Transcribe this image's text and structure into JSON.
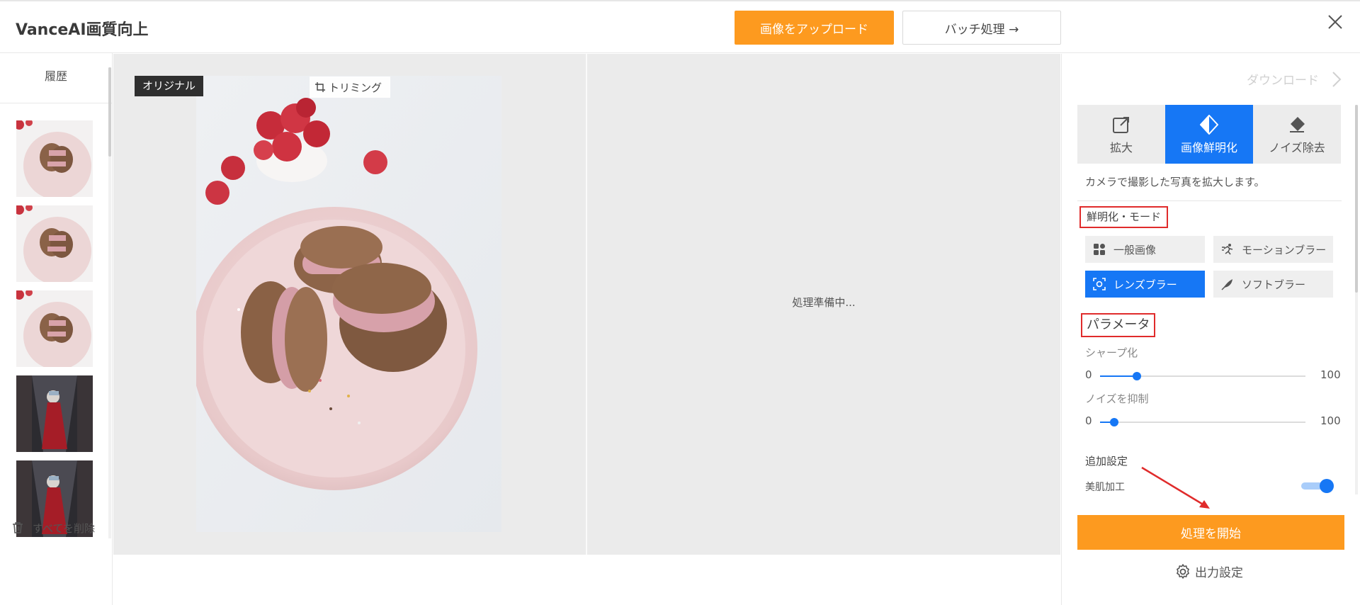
{
  "header": {
    "app_title": "VanceAI画質向上",
    "upload_label": "画像をアップロード",
    "batch_label": "バッチ処理 →"
  },
  "history": {
    "title": "履歴",
    "thumbnails": [
      "cookie-photo",
      "cookie-photo",
      "cookie-photo",
      "red-dress-alley-photo",
      "red-dress-alley-photo"
    ],
    "delete_all_label": "すべてを削除"
  },
  "preview": {
    "original_tag": "オリジナル",
    "trim_label": "トリミング",
    "processing_text": "処理準備中..."
  },
  "panel": {
    "download_label": "ダウンロード",
    "tabs": [
      {
        "label": "拡大",
        "icon": "enlarge-icon",
        "active": false
      },
      {
        "label": "画像鮮明化",
        "icon": "sharpen-icon",
        "active": true
      },
      {
        "label": "ノイズ除去",
        "icon": "eraser-icon",
        "active": false
      }
    ],
    "description": "カメラで撮影した写真を拡大します。",
    "mode_section_label": "鮮明化・モード",
    "modes": [
      {
        "label": "一般画像",
        "icon": "grid-icon",
        "active": false
      },
      {
        "label": "モーションブラー",
        "icon": "running-icon",
        "active": false
      },
      {
        "label": "レンズブラー",
        "icon": "lens-focus-icon",
        "active": true
      },
      {
        "label": "ソフトブラー",
        "icon": "feather-icon",
        "active": false
      }
    ],
    "param_section_label": "パラメータ",
    "sliders": [
      {
        "label": "シャープ化",
        "min": "0",
        "max": "100",
        "value": 18
      },
      {
        "label": "ノイズを抑制",
        "min": "0",
        "max": "100",
        "value": 7
      }
    ],
    "extra_settings_label": "追加設定",
    "skin_label": "美肌加工",
    "skin_enabled": true,
    "start_label": "処理を開始",
    "output_settings_label": "出力設定"
  },
  "colors": {
    "accent_orange": "#fd9a1f",
    "accent_blue": "#1677f5",
    "annotation_red": "#e02b2b"
  }
}
